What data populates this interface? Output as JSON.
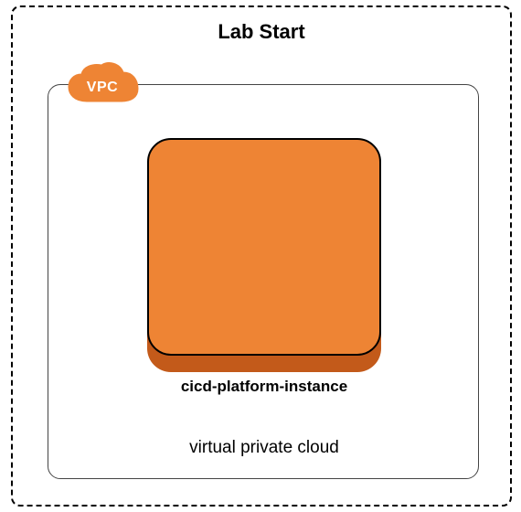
{
  "title": "Lab Start",
  "vpc": {
    "badge": "VPC",
    "label": "virtual private cloud"
  },
  "instance": {
    "name": "cicd-platform-instance"
  },
  "colors": {
    "accent": "#ee8434",
    "accent_dark": "#c35a1a"
  }
}
